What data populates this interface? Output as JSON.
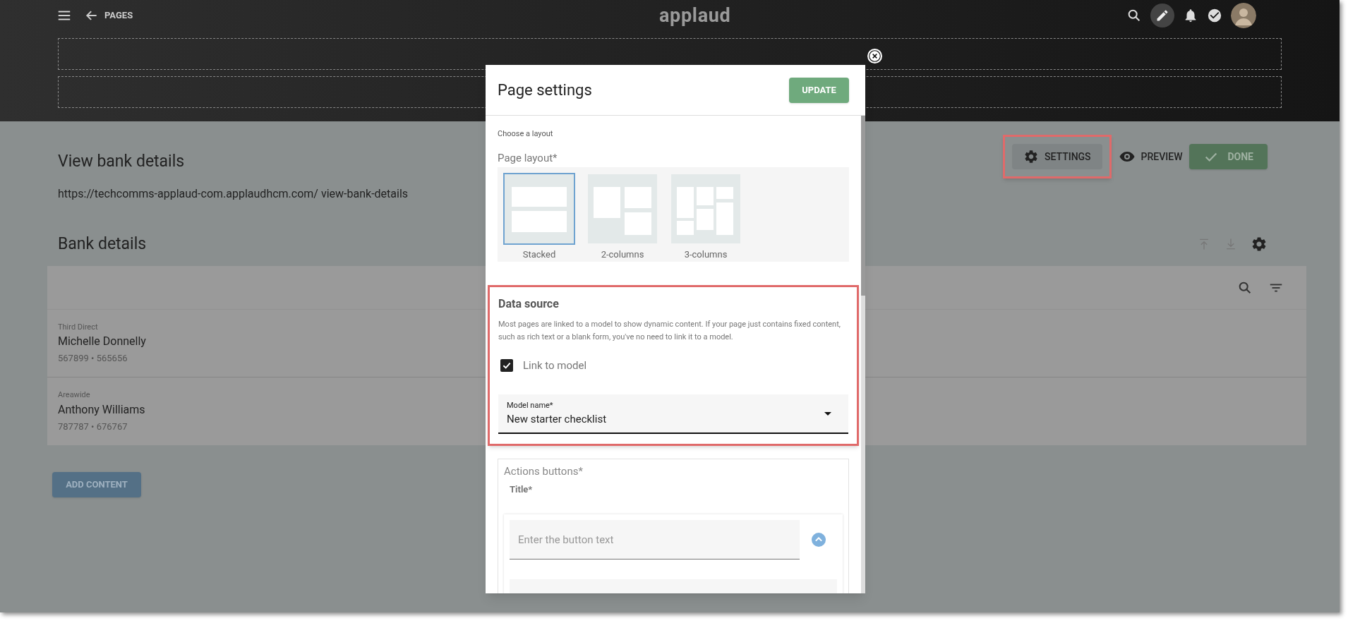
{
  "top_bar": {
    "back_label": "PAGES",
    "logo": "applaud"
  },
  "page": {
    "title": "View bank details",
    "url": "https://techcomms-applaud-com.applaudhcm.com/ view-bank-details",
    "actions": [
      {
        "kind": "settings",
        "label": "SETTINGS",
        "highlighted": true
      },
      {
        "kind": "preview",
        "label": "PREVIEW",
        "highlighted": false
      },
      {
        "kind": "done",
        "label": "DONE",
        "highlighted": false
      }
    ]
  },
  "section": {
    "title": "Bank details",
    "rows": [
      {
        "bank": "Third Direct",
        "name": "Michelle Donnelly",
        "numbers": "567899 • 565656"
      },
      {
        "bank": "Areawide",
        "name": "Anthony Williams",
        "numbers": "787787 • 676767"
      }
    ],
    "add_button": "ADD CONTENT"
  },
  "dialog": {
    "title": "Page settings",
    "update_button": "UPDATE",
    "layout_hint": "Choose a layout",
    "layout_label": "Page layout*",
    "layouts": [
      {
        "kind": "stacked",
        "label": "Stacked",
        "selected": true
      },
      {
        "kind": "two",
        "label": "2-columns",
        "selected": false
      },
      {
        "kind": "three",
        "label": "3-columns",
        "selected": false
      }
    ],
    "data_source": {
      "title": "Data source",
      "highlighted": true,
      "description": "Most pages are linked to a model to show dynamic content. If your page just contains fixed content, such as rich text or a blank form, you've no need to link it to a model.",
      "checkbox": {
        "label": "Link to model",
        "checked": true
      },
      "model_label": "Model name*",
      "model_value": "New starter checklist"
    },
    "actions_section": {
      "title": "Actions buttons*",
      "subtitle": "Title*",
      "placeholder": "Enter the button text"
    }
  }
}
